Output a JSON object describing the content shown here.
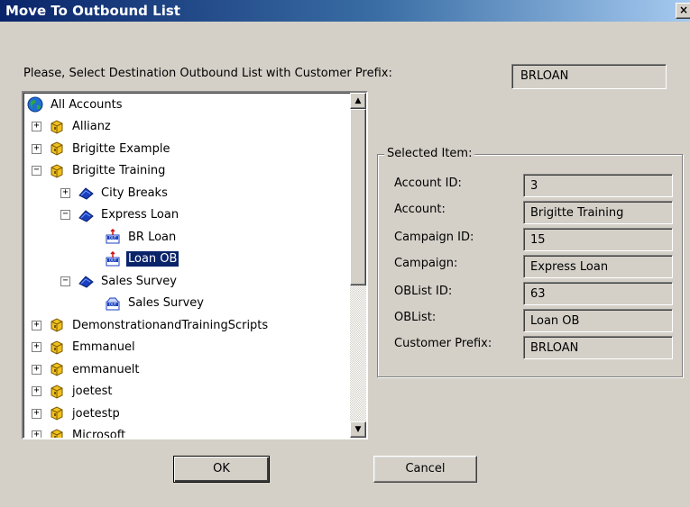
{
  "window": {
    "title": "Move To Outbound List",
    "close_label": "×"
  },
  "prompt": "Please, Select Destination Outbound List with Customer Prefix:",
  "prefix_value": "BRLOAN",
  "tree": {
    "items": [
      {
        "label": "All Accounts",
        "icon": "globe-icon",
        "expander": ""
      },
      {
        "label": "Allianz",
        "icon": "account-box-icon",
        "expander": "+"
      },
      {
        "label": "Brigitte Example",
        "icon": "account-box-icon",
        "expander": "+"
      },
      {
        "label": "Brigitte Training",
        "icon": "account-box-icon",
        "expander": "−"
      },
      {
        "label": "City Breaks",
        "icon": "campaign-icon",
        "expander": "+"
      },
      {
        "label": "Express Loan",
        "icon": "campaign-icon",
        "expander": "−"
      },
      {
        "label": "BR Loan",
        "icon": "outbound-list-active-icon",
        "expander": ""
      },
      {
        "label": "Loan OB",
        "icon": "outbound-list-active-icon",
        "expander": "",
        "selected": true
      },
      {
        "label": "Sales Survey",
        "icon": "campaign-icon",
        "expander": "−"
      },
      {
        "label": "Sales Survey",
        "icon": "outbound-list-icon",
        "expander": ""
      },
      {
        "label": "DemonstrationandTrainingScripts",
        "icon": "account-box-icon",
        "expander": "+"
      },
      {
        "label": "Emmanuel",
        "icon": "account-box-icon",
        "expander": "+"
      },
      {
        "label": "emmanuelt",
        "icon": "account-box-icon",
        "expander": "+"
      },
      {
        "label": "joetest",
        "icon": "account-box-icon",
        "expander": "+"
      },
      {
        "label": "joetestp",
        "icon": "account-box-icon",
        "expander": "+"
      },
      {
        "label": "Microsoft",
        "icon": "account-box-icon",
        "expander": "+"
      }
    ]
  },
  "selected_item": {
    "legend": "Selected Item:",
    "fields": [
      {
        "label": "Account ID:",
        "value": "3"
      },
      {
        "label": "Account:",
        "value": "Brigitte Training"
      },
      {
        "label": "Campaign ID:",
        "value": "15"
      },
      {
        "label": "Campaign:",
        "value": "Express Loan"
      },
      {
        "label": "OBList ID:",
        "value": "63"
      },
      {
        "label": "OBList:",
        "value": "Loan OB"
      },
      {
        "label": "Customer Prefix:",
        "value": "BRLOAN"
      }
    ]
  },
  "buttons": {
    "ok": "OK",
    "cancel": "Cancel"
  },
  "colors": {
    "title_bar": "#0a246a",
    "selection": "#0a246a",
    "face": "#d4d0c8"
  }
}
